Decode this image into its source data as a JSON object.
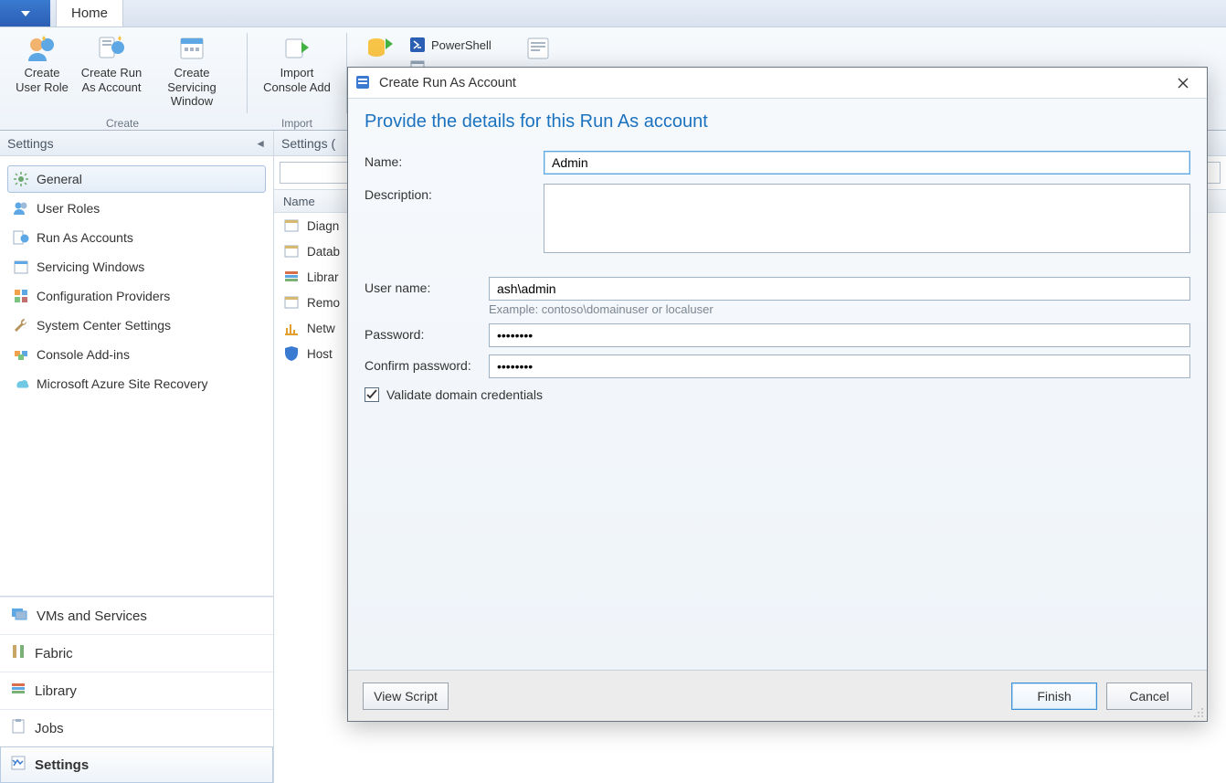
{
  "menu": {
    "home_tab": "Home"
  },
  "ribbon": {
    "create_user_role": "Create\nUser Role",
    "create_run_as": "Create Run\nAs Account",
    "create_servicing": "Create Servicing\nWindow",
    "group_create": "Create",
    "import_console": "Import\nConsole Add",
    "group_import": "Import",
    "powershell": "PowerShell"
  },
  "settings_panel": {
    "title": "Settings",
    "items": [
      {
        "label": "General",
        "icon": "gear-icon",
        "selected": true
      },
      {
        "label": "User Roles",
        "icon": "users-icon",
        "selected": false
      },
      {
        "label": "Run As Accounts",
        "icon": "account-icon",
        "selected": false
      },
      {
        "label": "Servicing Windows",
        "icon": "calendar-icon",
        "selected": false
      },
      {
        "label": "Configuration Providers",
        "icon": "blocks-icon",
        "selected": false
      },
      {
        "label": "System Center Settings",
        "icon": "wrench-icon",
        "selected": false
      },
      {
        "label": "Console Add-ins",
        "icon": "addin-icon",
        "selected": false
      },
      {
        "label": "Microsoft Azure Site Recovery",
        "icon": "cloud-icon",
        "selected": false
      }
    ],
    "nav": [
      {
        "label": "VMs and Services",
        "icon": "vm-icon"
      },
      {
        "label": "Fabric",
        "icon": "fabric-icon"
      },
      {
        "label": "Library",
        "icon": "library-icon"
      },
      {
        "label": "Jobs",
        "icon": "jobs-icon"
      },
      {
        "label": "Settings",
        "icon": "settings-icon",
        "selected": true
      }
    ]
  },
  "content": {
    "header": "Settings (",
    "column_name": "Name",
    "rows": [
      {
        "label": "Diagn"
      },
      {
        "label": "Datab"
      },
      {
        "label": "Librar"
      },
      {
        "label": "Remo"
      },
      {
        "label": "Netw"
      },
      {
        "label": "Host "
      }
    ],
    "search_placeholder": ""
  },
  "dialog": {
    "title": "Create Run As Account",
    "heading": "Provide the details for this Run As account",
    "name_label": "Name:",
    "name_value": "Admin",
    "desc_label": "Description:",
    "desc_value": "",
    "user_label": "User name:",
    "user_value": "ash\\admin",
    "user_hint": "Example: contoso\\domainuser or localuser",
    "pwd_label": "Password:",
    "pwd_value": "••••••••",
    "cpwd_label": "Confirm password:",
    "cpwd_value": "••••••••",
    "validate_label": "Validate domain credentials",
    "validate_checked": true,
    "view_script": "View Script",
    "finish": "Finish",
    "cancel": "Cancel"
  }
}
